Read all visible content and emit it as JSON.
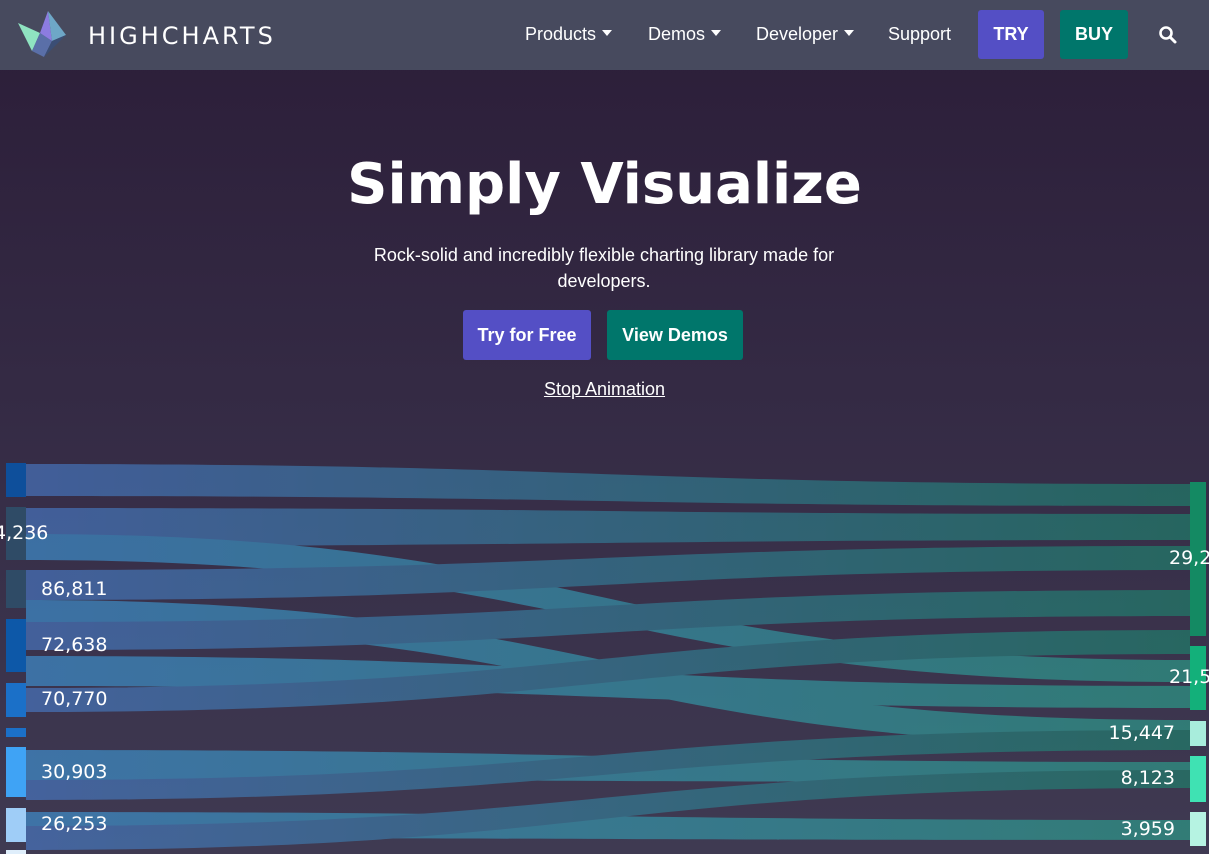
{
  "header": {
    "brand": "HIGHCHARTS",
    "nav": [
      {
        "label": "Products",
        "has_dropdown": true
      },
      {
        "label": "Demos",
        "has_dropdown": true
      },
      {
        "label": "Developer",
        "has_dropdown": true
      },
      {
        "label": "Support",
        "has_dropdown": false
      }
    ],
    "try_label": "TRY",
    "buy_label": "BUY",
    "search_icon": "search-icon"
  },
  "hero": {
    "title": "Simply Visualize",
    "subtitle": "Rock-solid and incredibly flexible charting library made for developers.",
    "primary_cta": "Try for Free",
    "secondary_cta": "View Demos",
    "stop_animation": "Stop Animation"
  },
  "colors": {
    "nav_bg": "#474a5e",
    "purple": "#544fc5",
    "teal": "#00766b"
  },
  "sankey": {
    "left_labels": [
      "4,236",
      "86,811",
      "72,638",
      "70,770",
      "30,903",
      "26,253"
    ],
    "right_labels": [
      "29,2",
      "21,5",
      "15,447",
      "8,123",
      "3,959"
    ]
  }
}
